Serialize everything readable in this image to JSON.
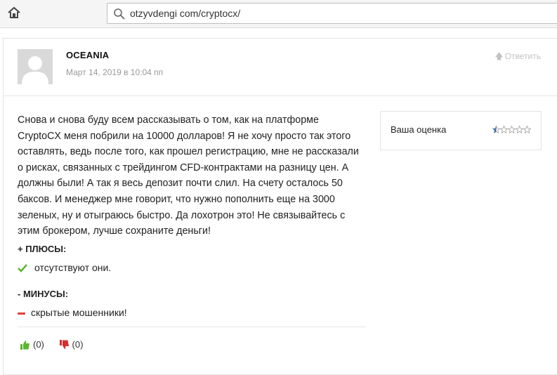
{
  "browser": {
    "url": "otzyvdengi com/cryptocx/",
    "icons": [
      "home-icon",
      "search-icon"
    ]
  },
  "review": {
    "author": "OCEANIA",
    "date": "Март 14, 2019 в 10:04 пп",
    "reply_label": "Ответить",
    "text": "Снова и снова буду всем рассказывать о том, как на платформе CryptoCX меня побрили на 10000 долларов! Я не хочу просто так этого оставлять, ведь после того, как прошел регистрацию, мне не рассказали о рисках, связанных с трейдингом CFD-контрактами на разницу цен. А должны были! А так я весь депозит почти слил. На счету осталось 50 баксов. И менеджер мне говорит, что нужно пополнить еще на 3000 зеленых, ну и отыграюсь быстро. Да лохотрон это! Не связывайтесь с этим брокером, лучше сохраните деньги!",
    "pros_title": "+ ПЛЮСЫ:",
    "pros_item": "отсутствуют они.",
    "cons_title": "- МИНУСЫ:",
    "cons_item": "скрытые мошенники!",
    "likes": "(0)",
    "dislikes": "(0)"
  },
  "rating": {
    "label": "Ваша оценка",
    "stars_total": 5,
    "stars_value": 0.5,
    "star_color": "#3a6fb0"
  },
  "colors": {
    "check": "#5cb531",
    "dash": "#e23b3b",
    "thumb_up": "#5cb531",
    "thumb_down": "#d33030"
  }
}
